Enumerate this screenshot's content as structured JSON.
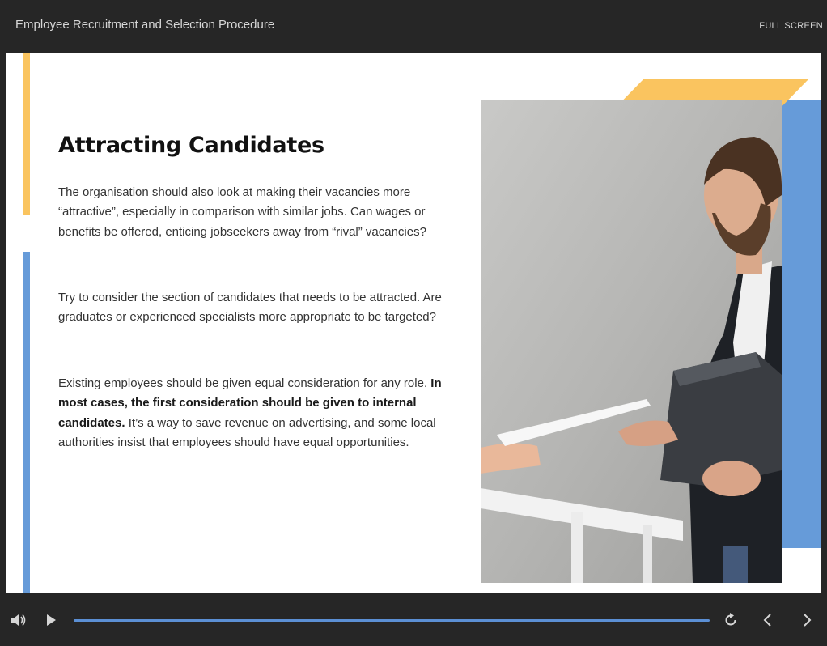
{
  "header": {
    "title": "Employee Recruitment and Selection Procedure",
    "fullscreen_label": "FULL SCREEN"
  },
  "slide": {
    "heading": "Attracting Candidates",
    "paragraph1": "The organisation should also look at making their vacancies more “attractive”, especially in comparison with similar jobs. Can wages or benefits be offered, enticing jobseekers away from “rival” vacancies?",
    "paragraph2": "Try to consider the section of candidates that needs to be attracted.  Are graduates or experienced specialists more appropriate to be targeted?",
    "paragraph3_start": "Existing employees should be given equal consideration for any role. ",
    "paragraph3_bold": "In most cases, the first consideration should be given to internal candidates.",
    "paragraph3_end": " It’s a way to save revenue on advertising, and some local authorities insist that employees should have equal opportunities."
  },
  "controls": {
    "icons": [
      "volume-icon",
      "play-icon",
      "replay-icon",
      "chevron-left-icon",
      "chevron-right-icon"
    ],
    "progress": 1.0
  },
  "colors": {
    "accent_yellow": "#fac45f",
    "accent_blue": "#669bd9",
    "chrome": "#262626",
    "progress": "#5b8fd4"
  }
}
